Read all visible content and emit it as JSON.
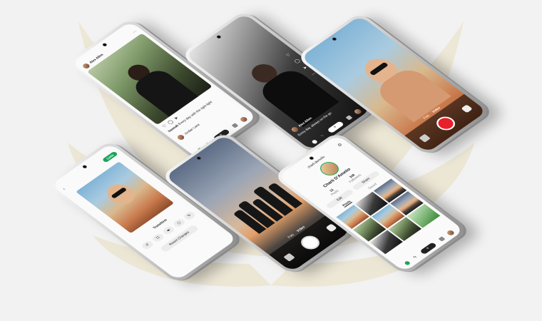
{
  "feed_screen": {
    "user_name": "Alex Allen",
    "caption_user": "hannah",
    "caption_text": "Every day with the right light",
    "comment_user": "Jordan Lane"
  },
  "reels_screen": {
    "user_name": "Alex Allen",
    "caption_text": "Every day, always on the go"
  },
  "camera_screen": {
    "mode_photo": "Foto",
    "mode_video": "Vídeo",
    "record_color": "#e8202a"
  },
  "editor_screen": {
    "save_label": "Listo",
    "section_title": "Transform",
    "reset_label": "Revert Changes",
    "tools": [
      "↺",
      "⊡",
      "◂▸",
      "◻",
      "↻"
    ]
  },
  "group_camera_screen": {
    "mode_photo": "Foto",
    "mode_video": "Vídeo"
  },
  "profile_screen": {
    "handle": "charli.damelio",
    "display_name": "Charli D'Amelio",
    "posts_count": "12",
    "posts_label": "Posts",
    "followers_count": "348",
    "followers_label": "Followers",
    "edit_label": "Edit",
    "share_label": "Share",
    "tab_posts": "Posts",
    "tab_saved": "Saved"
  },
  "colors": {
    "accent_green": "#1aa35a",
    "record_red": "#e8202a",
    "background": "#f2f2f2",
    "wing": "#ece4cf"
  }
}
